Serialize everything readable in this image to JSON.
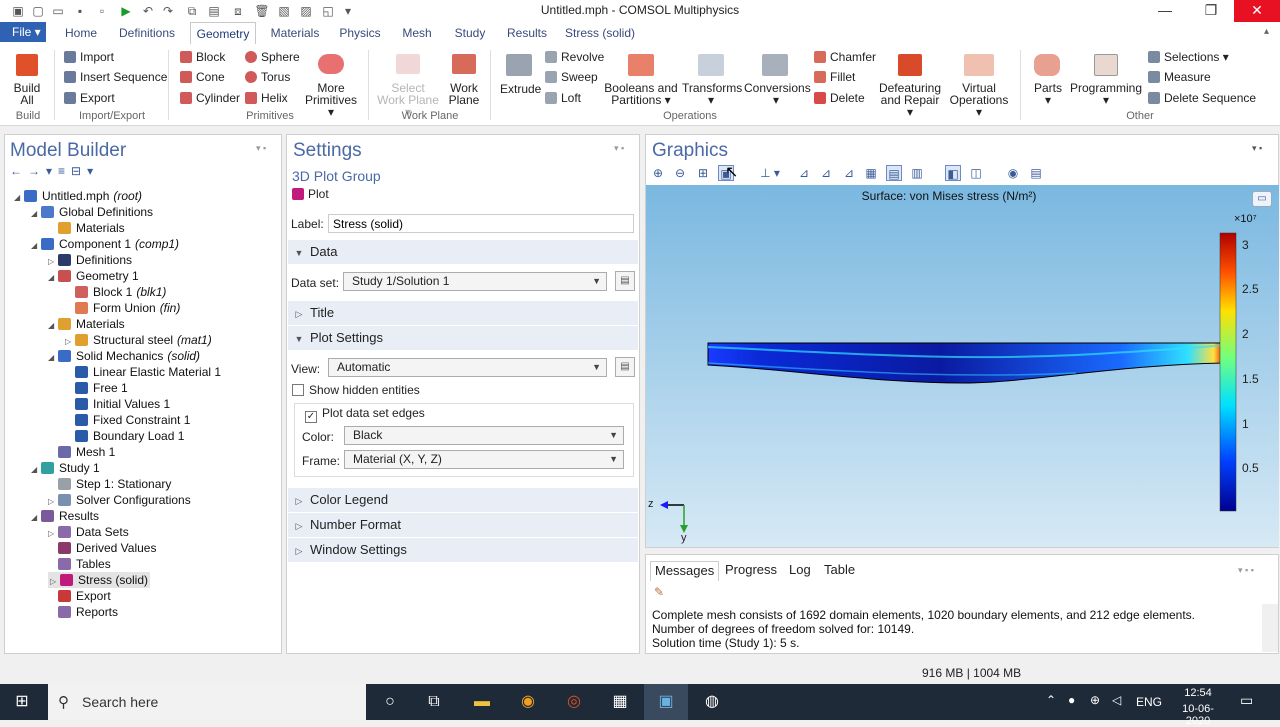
{
  "window": {
    "title": "Untitled.mph - COMSOL Multiphysics",
    "min": "—",
    "restore": "❐",
    "close": "✕"
  },
  "quick_access": {
    "icons": [
      "new-icon",
      "open-icon",
      "save-icon",
      "save-as-icon",
      "run-icon",
      "undo-icon",
      "redo-icon",
      "copy-icon",
      "paste-icon",
      "duplicate-icon",
      "delete-icon",
      "clear-icon",
      "select-icon",
      "overflow-icon"
    ]
  },
  "menu": {
    "file": "File ▾",
    "tabs": [
      "Home",
      "Definitions",
      "Geometry",
      "Materials",
      "Physics",
      "Mesh",
      "Study",
      "Results",
      "Stress (solid)"
    ],
    "active": "Geometry"
  },
  "ribbon": {
    "build_all": "Build All",
    "build_group": "Build",
    "import": "Import",
    "insert_sequence": "Insert Sequence",
    "export": "Export",
    "import_export_group": "Import/Export",
    "block": "Block",
    "cone": "Cone",
    "cylinder": "Cylinder",
    "sphere": "Sphere",
    "torus": "Torus",
    "helix": "Helix",
    "more_primitives": "More Primitives ▾",
    "primitives_group": "Primitives",
    "select_work_plane": "Select Work Plane ▾",
    "work_plane": "Work Plane",
    "work_plane_group": "Work Plane",
    "extrude": "Extrude",
    "revolve": "Revolve",
    "sweep": "Sweep",
    "loft": "Loft",
    "booleans": "Booleans and Partitions ▾",
    "transforms": "Transforms ▾",
    "conversions": "Conversions ▾",
    "chamfer": "Chamfer",
    "fillet": "Fillet",
    "delete": "Delete",
    "operations_group": "Operations",
    "defeaturing": "Defeaturing and Repair ▾",
    "virtual_operations": "Virtual Operations ▾",
    "parts": "Parts ▾",
    "programming": "Programming ▾",
    "selections": "Selections ▾",
    "measure": "Measure",
    "delete_sequence": "Delete Sequence",
    "other_group": "Other"
  },
  "model_builder": {
    "title": "Model Builder",
    "tree": [
      {
        "label": "Untitled.mph",
        "tag": "(root)",
        "indent": 0,
        "exp": "◢",
        "icon": "#3a6cc7"
      },
      {
        "label": "Global Definitions",
        "tag": "",
        "indent": 1,
        "exp": "◢",
        "icon": "#4a7ac9"
      },
      {
        "label": "Materials",
        "tag": "",
        "indent": 2,
        "exp": "",
        "icon": "#e0a030"
      },
      {
        "label": "Component 1",
        "tag": "(comp1)",
        "indent": 1,
        "exp": "◢",
        "icon": "#3a6cc7"
      },
      {
        "label": "Definitions",
        "tag": "",
        "indent": 2,
        "exp": "▷",
        "icon": "#2a3a6a"
      },
      {
        "label": "Geometry 1",
        "tag": "",
        "indent": 2,
        "exp": "◢",
        "icon": "#c85050"
      },
      {
        "label": "Block 1",
        "tag": "(blk1)",
        "indent": 3,
        "exp": "",
        "icon": "#d06060"
      },
      {
        "label": "Form Union",
        "tag": "(fin)",
        "indent": 3,
        "exp": "",
        "icon": "#e07a50"
      },
      {
        "label": "Materials",
        "tag": "",
        "indent": 2,
        "exp": "◢",
        "icon": "#e0a030"
      },
      {
        "label": "Structural steel",
        "tag": "(mat1)",
        "indent": 3,
        "exp": "▷",
        "icon": "#e0a030"
      },
      {
        "label": "Solid Mechanics",
        "tag": "(solid)",
        "indent": 2,
        "exp": "◢",
        "icon": "#3a6cc7"
      },
      {
        "label": "Linear Elastic Material 1",
        "tag": "",
        "indent": 3,
        "exp": "",
        "icon": "#2a5aa8"
      },
      {
        "label": "Free 1",
        "tag": "",
        "indent": 3,
        "exp": "",
        "icon": "#2a5aa8"
      },
      {
        "label": "Initial Values 1",
        "tag": "",
        "indent": 3,
        "exp": "",
        "icon": "#2a5aa8"
      },
      {
        "label": "Fixed Constraint 1",
        "tag": "",
        "indent": 3,
        "exp": "",
        "icon": "#2a5aa8"
      },
      {
        "label": "Boundary Load 1",
        "tag": "",
        "indent": 3,
        "exp": "",
        "icon": "#2a5aa8"
      },
      {
        "label": "Mesh 1",
        "tag": "",
        "indent": 2,
        "exp": "",
        "icon": "#6a6aa8"
      },
      {
        "label": "Study 1",
        "tag": "",
        "indent": 1,
        "exp": "◢",
        "icon": "#30a0a0"
      },
      {
        "label": "Step 1: Stationary",
        "tag": "",
        "indent": 2,
        "exp": "",
        "icon": "#9aa0a8"
      },
      {
        "label": "Solver Configurations",
        "tag": "",
        "indent": 2,
        "exp": "▷",
        "icon": "#7a90b0"
      },
      {
        "label": "Results",
        "tag": "",
        "indent": 1,
        "exp": "◢",
        "icon": "#7a5a9a"
      },
      {
        "label": "Data Sets",
        "tag": "",
        "indent": 2,
        "exp": "▷",
        "icon": "#8a6aa8"
      },
      {
        "label": "Derived Values",
        "tag": "",
        "indent": 2,
        "exp": "",
        "icon": "#8a3a6a"
      },
      {
        "label": "Tables",
        "tag": "",
        "indent": 2,
        "exp": "",
        "icon": "#8a6aa8"
      },
      {
        "label": "Stress (solid)",
        "tag": "",
        "indent": 2,
        "exp": "▷",
        "icon": "#c01a7a",
        "selected": true
      },
      {
        "label": "Export",
        "tag": "",
        "indent": 2,
        "exp": "",
        "icon": "#c83a3a"
      },
      {
        "label": "Reports",
        "tag": "",
        "indent": 2,
        "exp": "",
        "icon": "#8a6aa8"
      }
    ]
  },
  "settings": {
    "title": "Settings",
    "subtitle": "3D Plot Group",
    "plot": "Plot",
    "label_caption": "Label:",
    "label_value": "Stress (solid)",
    "sec_data": "Data",
    "dataset_caption": "Data set:",
    "dataset_value": "Study 1/Solution 1",
    "sec_title": "Title",
    "sec_plot_settings": "Plot Settings",
    "view_caption": "View:",
    "view_value": "Automatic",
    "show_hidden": "Show hidden entities",
    "plot_edges": "Plot data set edges",
    "color_caption": "Color:",
    "color_value": "Black",
    "frame_caption": "Frame:",
    "frame_value": "Material  (X, Y, Z)",
    "sec_color_legend": "Color Legend",
    "sec_number_format": "Number Format",
    "sec_window_settings": "Window Settings"
  },
  "graphics": {
    "title": "Graphics",
    "plot_title": "Surface: von Mises stress (N/m²)",
    "scale_exp": "×10⁷",
    "ticks": [
      "3",
      "2.5",
      "2",
      "1.5",
      "1",
      "0.5"
    ],
    "axis_z": "z",
    "axis_y": "y"
  },
  "messages": {
    "tabs": [
      "Messages",
      "Progress",
      "Log",
      "Table"
    ],
    "lines": [
      "Complete mesh consists of 1692 domain elements, 1020 boundary elements, and 212 edge elements.",
      "Number of degrees of freedom solved for: 10149.",
      "Solution time (Study 1): 5 s."
    ]
  },
  "status": {
    "memory": "916 MB | 1004 MB"
  },
  "taskbar": {
    "search": "Search here",
    "lang": "ENG",
    "time": "12:54",
    "date": "10-06-2020"
  }
}
